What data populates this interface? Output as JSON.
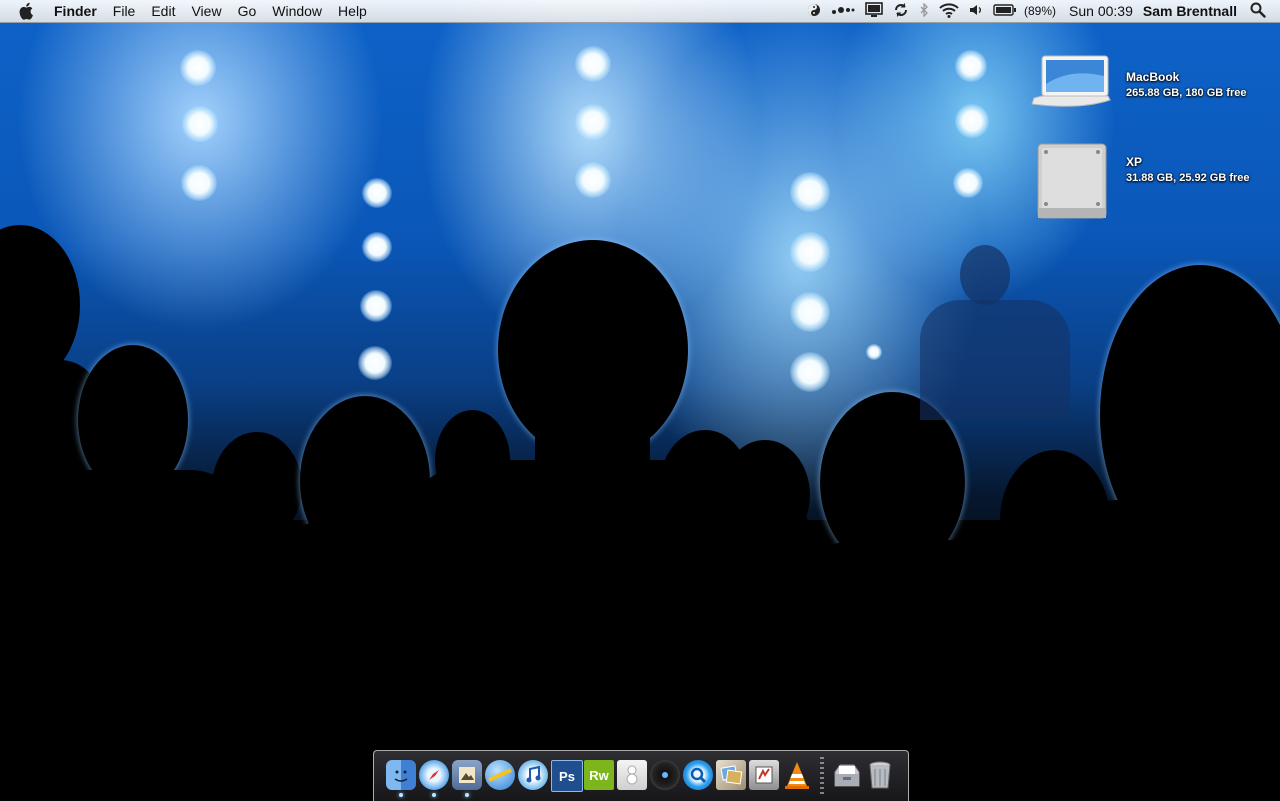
{
  "menubar": {
    "app_name": "Finder",
    "menus": [
      "File",
      "Edit",
      "View",
      "Go",
      "Window",
      "Help"
    ],
    "status": {
      "battery_percent": "(89%)",
      "clock": "Sun 00:39",
      "user": "Sam Brentnall"
    }
  },
  "desktop": {
    "icons": [
      {
        "name": "MacBook",
        "info": "265.88 GB, 180 GB free"
      },
      {
        "name": "XP",
        "info": "31.88 GB, 25.92 GB free"
      }
    ]
  },
  "dock": {
    "items": [
      {
        "icon": "finder-icon",
        "running": true
      },
      {
        "icon": "safari-icon",
        "running": true
      },
      {
        "icon": "preview-icon",
        "running": true
      },
      {
        "icon": "network-globe-icon",
        "running": false
      },
      {
        "icon": "itunes-icon",
        "running": false
      },
      {
        "icon": "photoshop-icon",
        "label": "Ps",
        "running": false
      },
      {
        "icon": "rapidweaver-icon",
        "label": "Rw",
        "running": false
      },
      {
        "icon": "app-icon",
        "running": false
      },
      {
        "icon": "dvd-player-icon",
        "running": false
      },
      {
        "icon": "quicktime-icon",
        "running": false
      },
      {
        "icon": "iphoto-icon",
        "running": false
      },
      {
        "icon": "utility-icon",
        "running": false
      },
      {
        "icon": "vlc-icon",
        "running": false
      },
      {
        "icon": "documents-stack-icon",
        "running": false
      },
      {
        "icon": "trash-icon",
        "running": false
      }
    ]
  }
}
